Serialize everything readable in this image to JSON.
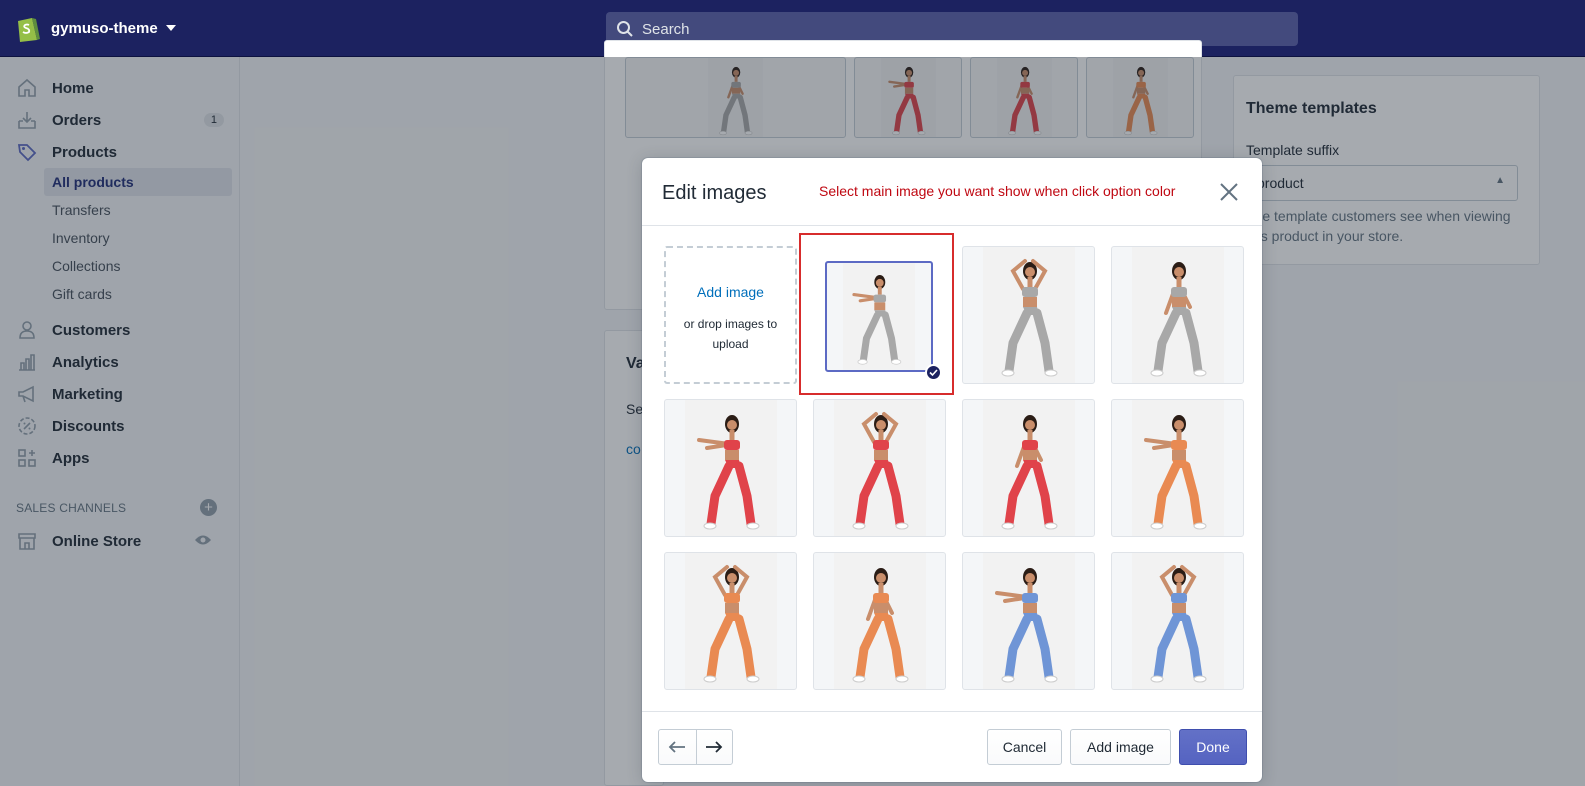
{
  "topbar": {
    "store_name": "gymuso-theme",
    "search_placeholder": "Search"
  },
  "sidebar": {
    "items": [
      {
        "label": "Home",
        "icon": "home-icon"
      },
      {
        "label": "Orders",
        "icon": "orders-icon",
        "badge": "1"
      },
      {
        "label": "Products",
        "icon": "tag-icon"
      },
      {
        "label": "Customers",
        "icon": "person-icon"
      },
      {
        "label": "Analytics",
        "icon": "bar-chart-icon"
      },
      {
        "label": "Marketing",
        "icon": "megaphone-icon"
      },
      {
        "label": "Discounts",
        "icon": "discount-icon"
      },
      {
        "label": "Apps",
        "icon": "apps-icon"
      }
    ],
    "product_subitems": [
      "All products",
      "Transfers",
      "Inventory",
      "Collections",
      "Gift cards"
    ],
    "sales_channels_heading": "SALES CHANNELS",
    "online_store": "Online Store"
  },
  "background": {
    "variants_partial": "Va",
    "select_partial": "Se",
    "link_partial": "co",
    "theme_templates": {
      "title": "Theme templates",
      "suffix_label": "Template suffix",
      "suffix_value": "product",
      "help": "The template customers see when viewing this product in your store."
    }
  },
  "modal": {
    "title": "Edit images",
    "note": "Select main image you want show when click option color",
    "add_image_link": "Add image",
    "drop_text": "or drop images to upload",
    "images": [
      {
        "color": "grey",
        "pose": "extend",
        "selected": true
      },
      {
        "color": "grey",
        "pose": "arms-up"
      },
      {
        "color": "grey",
        "pose": "side"
      },
      {
        "color": "red",
        "pose": "extend"
      },
      {
        "color": "red",
        "pose": "arms-up"
      },
      {
        "color": "red",
        "pose": "side"
      },
      {
        "color": "orange",
        "pose": "extend"
      },
      {
        "color": "orange",
        "pose": "arms-up"
      },
      {
        "color": "orange",
        "pose": "side"
      },
      {
        "color": "blue",
        "pose": "extend"
      },
      {
        "color": "blue",
        "pose": "arms-up"
      }
    ],
    "footer": {
      "cancel": "Cancel",
      "add_image": "Add image",
      "done": "Done"
    }
  },
  "colors": {
    "topbar": "#1c2260",
    "primary": "#5c6ac4",
    "note_red": "#bf0711",
    "highlight_red": "#d72c2c",
    "grey": "#a8a8a8",
    "red": "#e0434a",
    "orange": "#e98a52",
    "blue": "#6f95d6"
  }
}
